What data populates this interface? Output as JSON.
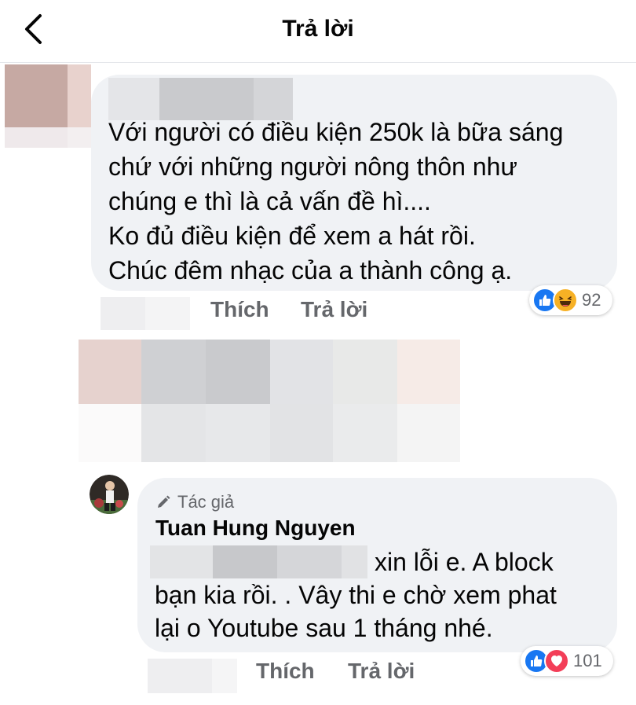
{
  "header": {
    "title": "Trả lời",
    "back_icon": "chevron-left-icon"
  },
  "comment1": {
    "lines": [
      "Với người có điều kiện 250k là bữa sáng",
      "chứ với những người nông thôn như",
      "chúng e thì là cả vấn đề hì....",
      "Ko đủ điều kiện để xem a hát rồi.",
      "Chúc đêm nhạc của a thành công ạ."
    ],
    "like_label": "Thích",
    "reply_label": "Trả lời",
    "reaction_icons": [
      "like-icon",
      "haha-icon"
    ],
    "reaction_count": "92"
  },
  "comment2": {
    "author_badge": "Tác giả",
    "author_name": "Tuan Hung Nguyen",
    "lines": [
      "xin lỗi e. A block",
      "bạn kia rồi. . Vây thi e chờ xem phat",
      "lại o Youtube sau 1 tháng nhé."
    ],
    "like_label": "Thích",
    "reply_label": "Trả lời",
    "reaction_icons": [
      "like-icon",
      "love-icon"
    ],
    "reaction_count": "101"
  },
  "colors": {
    "bubble": "#f0f2f5",
    "secondary_text": "#65676b",
    "like_blue": "#1877f2",
    "love_red": "#f33e58",
    "haha_yellow": "#f7b125"
  }
}
